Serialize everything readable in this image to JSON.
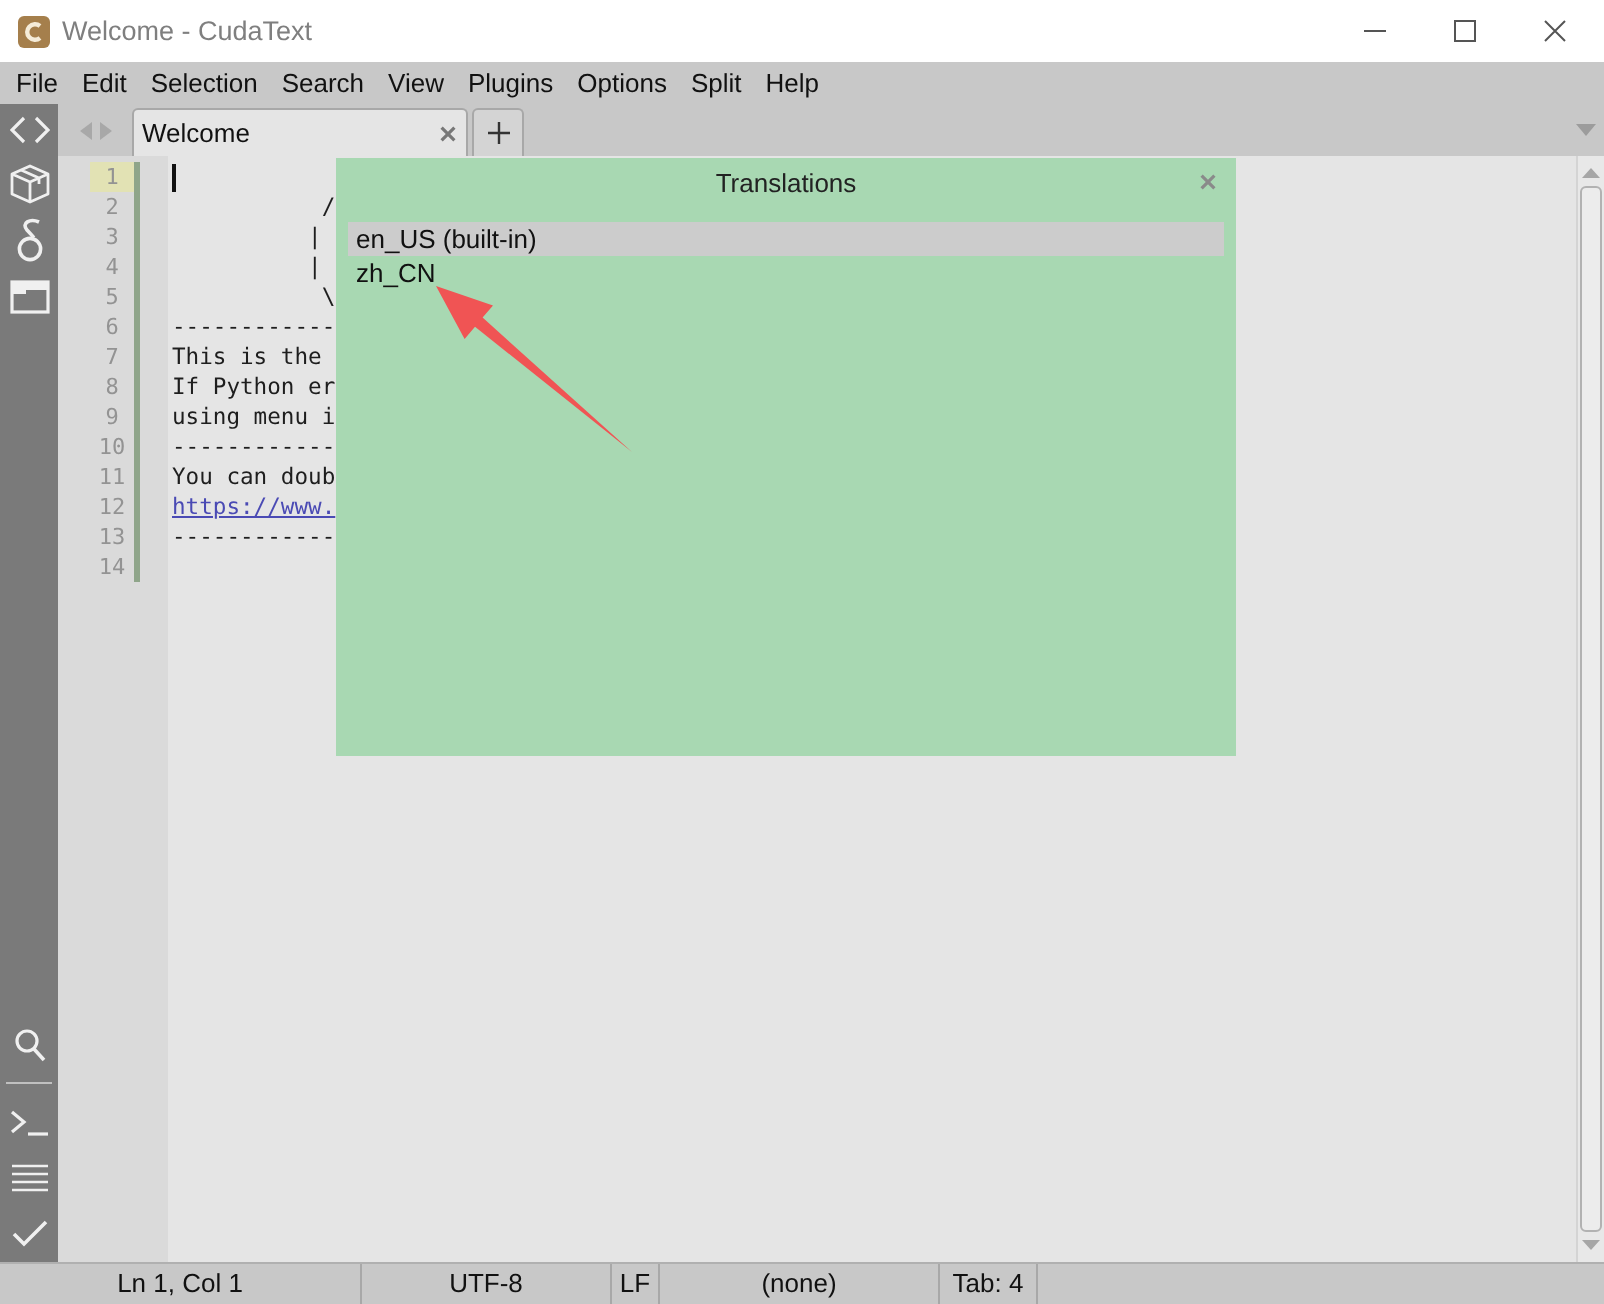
{
  "window": {
    "title": "Welcome - CudaText"
  },
  "menu": [
    "File",
    "Edit",
    "Selection",
    "Search",
    "View",
    "Plugins",
    "Options",
    "Split",
    "Help"
  ],
  "tabs": [
    {
      "label": "Welcome",
      "selected": true
    }
  ],
  "editor": {
    "lines": [
      {
        "number": "1",
        "current": true
      },
      {
        "number": "2",
        "current": false,
        "kind": "text",
        "text": "           /"
      },
      {
        "number": "3",
        "current": false,
        "kind": "text",
        "text": "          |"
      },
      {
        "number": "4",
        "current": false,
        "kind": "text",
        "text": "          |"
      },
      {
        "number": "5",
        "current": false,
        "kind": "text",
        "text": "           \\"
      },
      {
        "number": "6",
        "current": false,
        "kind": "text",
        "text": "------------"
      },
      {
        "number": "7",
        "current": false,
        "kind": "text",
        "text": "This is the"
      },
      {
        "number": "8",
        "current": false,
        "kind": "text",
        "text": "If Python er"
      },
      {
        "number": "9",
        "current": false,
        "kind": "text",
        "text": "using menu i"
      },
      {
        "number": "10",
        "current": false,
        "kind": "text",
        "text": "------------"
      },
      {
        "number": "11",
        "current": false,
        "kind": "text",
        "text": "You can doub"
      },
      {
        "number": "12",
        "current": false,
        "kind": "link",
        "text": "https://www."
      },
      {
        "number": "13",
        "current": false,
        "kind": "text",
        "text": "------------"
      },
      {
        "number": "14",
        "current": false
      }
    ]
  },
  "dialog": {
    "title": "Translations",
    "items": [
      {
        "label": "en_US (built-in)",
        "selected": true
      },
      {
        "label": "zh_CN",
        "selected": false
      }
    ]
  },
  "status_bar": {
    "cells": [
      "Ln 1, Col 1",
      "UTF-8",
      "LF",
      "(none)",
      "Tab: 4"
    ]
  }
}
